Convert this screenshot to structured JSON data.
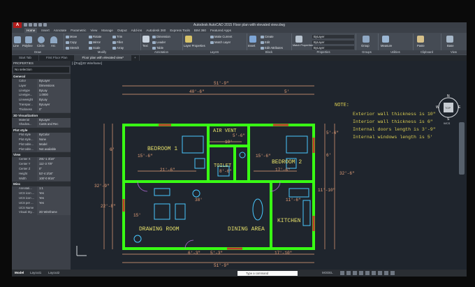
{
  "window": {
    "app_logo": "A",
    "title": "Autodesk AutoCAD 2015   Floor plan with elevated view.dwg"
  },
  "ribbon_tabs": [
    "Home",
    "Insert",
    "Annotate",
    "Parametric",
    "View",
    "Manage",
    "Output",
    "Add-ins",
    "Autodesk 360",
    "Express Tools",
    "BIM 360",
    "Featured Apps"
  ],
  "ribbon": {
    "draw": {
      "label": "Draw",
      "tools": [
        "Line",
        "Polyline",
        "Circle",
        "Arc"
      ]
    },
    "modify": {
      "label": "Modify",
      "tools": [
        "Move",
        "Rotate",
        "Trim",
        "Copy",
        "Mirror",
        "Fillet",
        "Stretch",
        "Scale",
        "Array"
      ]
    },
    "annotation": {
      "label": "Annotation",
      "tools": [
        "Text",
        "Dimension",
        "Leader",
        "Table"
      ]
    },
    "layers": {
      "label": "Layers",
      "tools": [
        "Layer Properties",
        "Make Current",
        "Match Layer"
      ]
    },
    "block": {
      "label": "Block",
      "tools": [
        "Insert",
        "Create",
        "Edit",
        "Edit Attributes"
      ]
    },
    "properties": {
      "label": "Properties",
      "match": "Match Properties",
      "vals": [
        "ByLayer",
        "ByLayer",
        "ByLayer"
      ]
    },
    "groups": {
      "label": "Groups",
      "tool": "Group"
    },
    "utilities": {
      "label": "Utilities",
      "tool": "Measure"
    },
    "clipboard": {
      "label": "Clipboard",
      "tool": "Paste"
    },
    "view": {
      "label": "View",
      "tool": "Base"
    }
  },
  "doc_tabs": [
    "Start Tab",
    "First Floor Plan",
    "Floor plan with elevated view*"
  ],
  "properties_panel": {
    "title": "PROPERTIES",
    "selection": "No selection",
    "sections": [
      {
        "name": "General",
        "rows": [
          [
            "Color",
            "ByLayer"
          ],
          [
            "Layer",
            "Dimensions"
          ],
          [
            "Linetype",
            "ByLay"
          ],
          [
            "Linetype...",
            "1.0000"
          ],
          [
            "Lineweight",
            "ByLay"
          ],
          [
            "Transpar...",
            "ByLayer"
          ],
          [
            "Thickness",
            "0\""
          ]
        ]
      },
      {
        "name": "3D Visualization",
        "rows": [
          [
            "Material",
            "ByLayer"
          ],
          [
            "Shadow...",
            "Casts and Rec"
          ]
        ]
      },
      {
        "name": "Plot style",
        "rows": [
          [
            "Plot style",
            "ByColor"
          ],
          [
            "Plot style...",
            "None"
          ],
          [
            "Plot table...",
            "Model"
          ],
          [
            "Plot table...",
            "Not available"
          ]
        ]
      },
      {
        "name": "View",
        "rows": [
          [
            "Center X",
            "291'-1 3/16\""
          ],
          [
            "Center Y",
            "111'-3 7/8\""
          ],
          [
            "Center Z",
            "0\""
          ],
          [
            "Height",
            "53'-4 3/16\""
          ],
          [
            "Width",
            "100'-0 9/16\""
          ]
        ]
      },
      {
        "name": "Misc",
        "rows": [
          [
            "Annotati...",
            "1:1"
          ],
          [
            "UCS icon ...",
            "Yes"
          ],
          [
            "UCS icon ...",
            "Yes"
          ],
          [
            "UCS per ...",
            "Yes"
          ],
          [
            "UCS Name",
            ""
          ],
          [
            "Visual Sty...",
            "2D Wireframe"
          ]
        ]
      }
    ]
  },
  "viewport_label": "[-][Top][2D Wireframe]",
  "notes": {
    "heading": "NOTE:",
    "lines": [
      "Exterior wall thickness is 10\"",
      "Interior wall thickness is  6\"",
      "Internal doors length is 3'-9\"",
      "Internal windows length is 5'"
    ]
  },
  "rooms": {
    "bedroom1": "BEDROOM 1",
    "bedroom2": "BEDROOM 2",
    "air_vent": "AIR VENT",
    "toilet": "TOILET",
    "drawing_room": "DRAWING ROOM",
    "dining_area": "DINING AREA",
    "kitchen": "KITCHEN"
  },
  "dims": {
    "top_overall": "51'-9\"",
    "top_left": "40'-6\"",
    "top_right": "5'",
    "bottom_overall": "51'-9\"",
    "bottom_a": "6'-3\"",
    "bottom_b": "5'-3\"",
    "bottom_c": "17'-10\"",
    "left_overall": "32'-9\"",
    "left_a": "22'-8\"",
    "left_b": "6'",
    "right_overall": "32'-6\"",
    "right_a": "5'-6\"",
    "right_b": "6'",
    "right_c": "11'-10\"",
    "bed1_w": "15'-6\"",
    "bed1_inner": "21'-6\"",
    "bed2_w": "15'-6\"",
    "bed2_inner": "17'-6\"",
    "vent_w": "10'",
    "vent_h": "5'-6\"",
    "toilet_w": "8'-6\"",
    "center": "38'",
    "dr_depth": "15'",
    "kitchen_w": "11'-6\""
  },
  "viewcube": {
    "top": "TOP",
    "n": "N",
    "s": "S",
    "w": "W",
    "e": "E",
    "wcs": "WCS"
  },
  "status": {
    "model_tab": "Model",
    "layout1": "Layout1",
    "layout2": "Layout2",
    "cmd_placeholder": "Type a command",
    "model_label": "MODEL"
  },
  "colors": {
    "wall": "#39ff14",
    "dimension": "#e8a27a",
    "label": "#e6e06a",
    "furniture": "#48c8ff",
    "note": "#dccf52"
  }
}
